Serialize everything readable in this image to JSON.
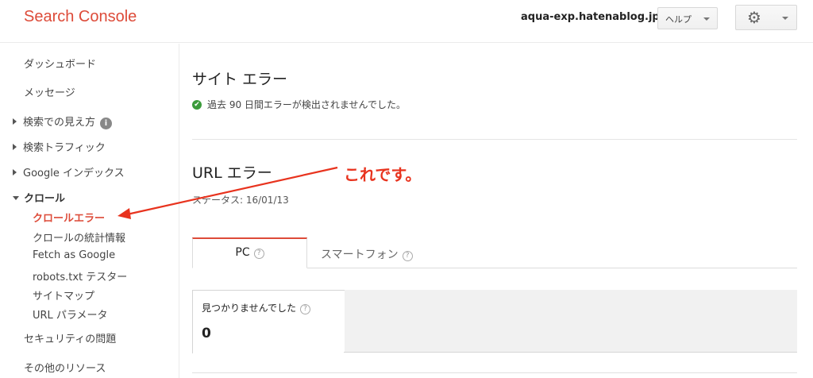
{
  "header": {
    "logo": "Search Console",
    "site": "aqua-exp.hatenablog.jp",
    "help_label": "ヘルプ"
  },
  "sidebar": {
    "dashboard": "ダッシュボード",
    "messages": "メッセージ",
    "search_appearance": "検索での見え方",
    "search_traffic": "検索トラフィック",
    "google_index": "Google インデックス",
    "crawl": "クロール",
    "crawl_items": [
      "クロールエラー",
      "クロールの統計情報",
      "Fetch as Google",
      "robots.txt テスター",
      "サイトマップ",
      "URL パラメータ"
    ],
    "security": "セキュリティの問題",
    "other_resources": "その他のリソース"
  },
  "main": {
    "site_errors_title": "サイト エラー",
    "site_errors_status": "過去 90 日間エラーが検出されませんでした。",
    "url_errors_title": "URL エラー",
    "status": "ステータス: 16/01/13",
    "tabs": [
      "PC",
      "スマートフォン"
    ],
    "card_label": "見つかりませんでした",
    "card_value": "0"
  },
  "annotation": "これです。",
  "colors": {
    "brand_red": "#dd4b39",
    "annotation_red": "#e8331e",
    "ok_green": "#3b9b3b"
  },
  "icons": [
    "gear-icon",
    "info-icon",
    "check-circle-icon",
    "help-circle-icon",
    "chevron-down-icon",
    "triangle-right-icon",
    "triangle-down-icon",
    "arrow-annotation"
  ]
}
